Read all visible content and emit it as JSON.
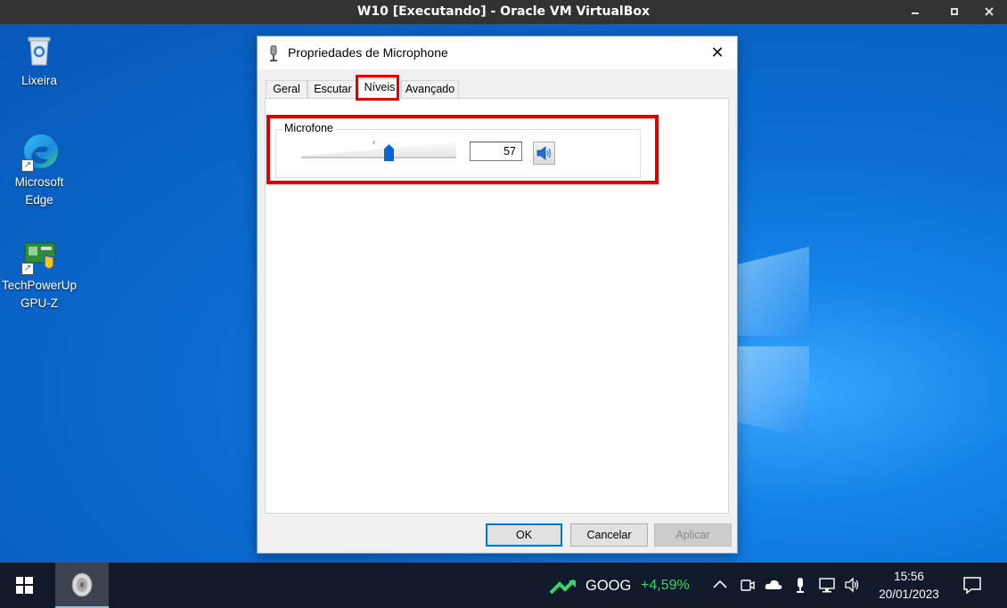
{
  "host": {
    "title": "W10 [Executando] - Oracle VM VirtualBox",
    "controls": [
      "minimize-icon",
      "maximize-icon",
      "close-icon"
    ]
  },
  "desktop": {
    "icons": [
      {
        "label_line1": "Lixeira",
        "label_line2": "",
        "icon": "recycle-bin-icon"
      },
      {
        "label_line1": "Microsoft",
        "label_line2": "Edge",
        "icon": "edge-icon"
      },
      {
        "label_line1": "TechPowerUp",
        "label_line2": "GPU-Z",
        "icon": "gpu-z-icon"
      }
    ]
  },
  "dialog": {
    "title": "Propriedades de Microphone",
    "title_icon": "microphone-icon",
    "tabs": [
      {
        "label": "Geral",
        "active": false
      },
      {
        "label": "Escutar",
        "active": false
      },
      {
        "label": "Níveis",
        "active": true
      },
      {
        "label": "Avançado",
        "active": false
      }
    ],
    "group_label": "Microfone",
    "level": {
      "value": "57",
      "fraction": 0.57
    },
    "mute_icon": "speaker-icon",
    "buttons": {
      "ok": "OK",
      "cancel": "Cancelar",
      "apply": "Aplicar"
    },
    "highlight_color": "#e00000"
  },
  "taskbar": {
    "start_icon": "windows-start-icon",
    "stock": {
      "symbol": "GOOG",
      "change": "+4,59%",
      "change_color": "#38d66a"
    },
    "tray_icons": [
      "chevron-up-icon",
      "meet-now-icon",
      "onedrive-icon",
      "microphone-icon",
      "network-icon",
      "volume-icon"
    ],
    "clock": {
      "time": "15:56",
      "date": "20/01/2023"
    },
    "notification_icon": "action-center-icon"
  }
}
